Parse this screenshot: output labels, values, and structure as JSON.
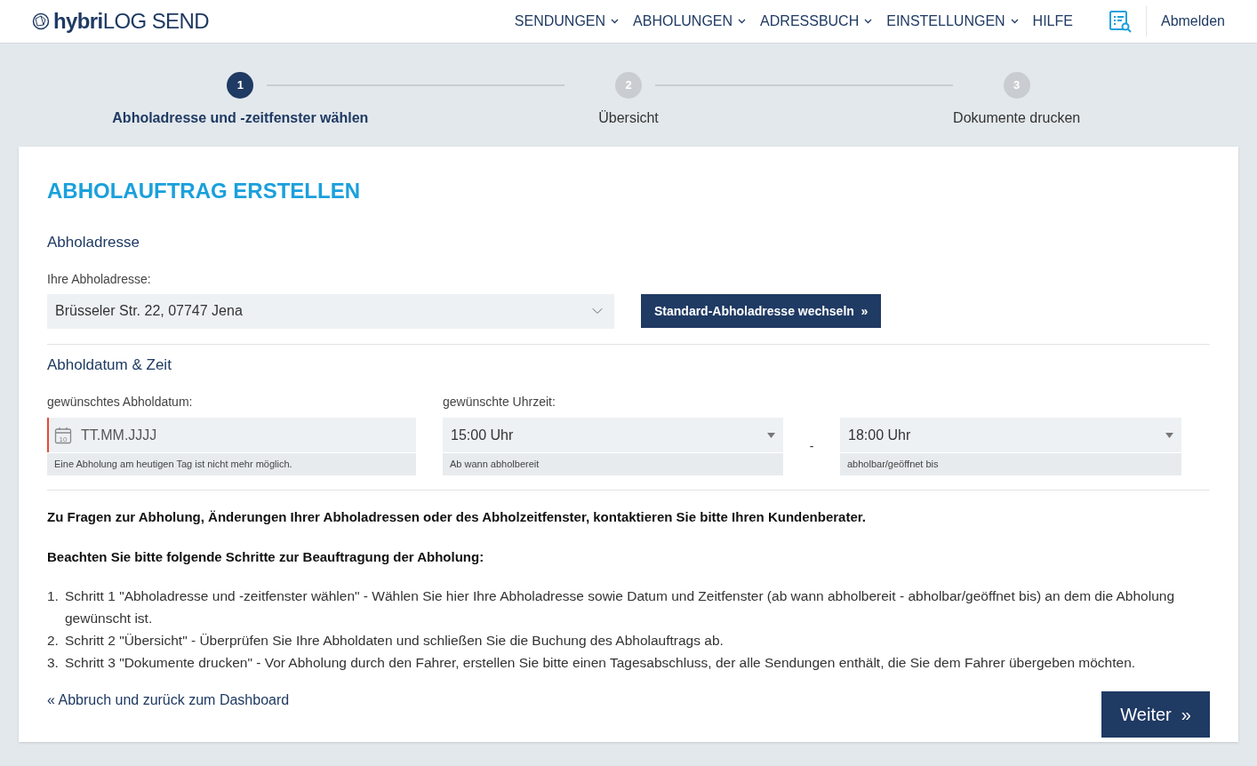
{
  "header": {
    "logo": "**hybri**LOG SEND",
    "nav": [
      {
        "label": "SENDUNGEN",
        "kind": "dropdown"
      },
      {
        "label": "ABHOLUNGEN",
        "kind": "dropdown"
      },
      {
        "label": "ADRESSBUCH",
        "kind": "dropdown"
      },
      {
        "label": "EINSTELLUNGEN",
        "kind": "dropdown"
      },
      {
        "label": "HILFE",
        "kind": "link"
      }
    ],
    "logout": "Abmelden"
  },
  "steps": [
    {
      "number": "1",
      "label": "Abholadresse und -zeitfenster wählen",
      "selected": true
    },
    {
      "number": "2",
      "label": "Übersicht",
      "selected": false
    },
    {
      "number": "3",
      "label": "Dokumente drucken",
      "selected": false
    }
  ],
  "title": "ABHOLAUFTRAG ERSTELLEN",
  "address_section": {
    "heading": "Abholadresse",
    "label": "Ihre Abholadresse:",
    "value": "Brüsseler Str. 22, 07747 Jena",
    "button": "Standard-Abholadresse wechseln  »"
  },
  "date_section": {
    "heading": "Abholdatum & Zeit",
    "date": {
      "label": "gewünschtes Abholdatum:",
      "placeholder": "TT.MM.JJJJ",
      "calendar_day": "10",
      "invalid": true,
      "hint": "Eine Abholung am heutigen Tag ist nicht mehr möglich."
    },
    "time_label": "gewünschte Uhrzeit:",
    "from": {
      "value": "15:00 Uhr",
      "hint": "Ab wann abholbereit"
    },
    "separator": "-",
    "to": {
      "value": "18:00 Uhr",
      "hint": "abholbar/geöffnet bis"
    }
  },
  "contact_note": "Zu Fragen zur Abholung, Änderungen Ihrer Abholadressen oder des Abholzeitfenster, kontaktieren Sie bitte Ihren Kundenberater.",
  "steps_heading": "Beachten Sie bitte folgende Schritte zur Beauftragung der Abholung:",
  "instructions": [
    {
      "marker": "1.",
      "text": "Schritt 1 \"Abholadresse und -zeitfenster wählen\" - Wählen Sie hier Ihre Abholadresse sowie Datum und Zeitfenster (ab wann abholbereit - abholbar/geöffnet bis) an dem die Abholung gewünscht ist."
    },
    {
      "marker": "2.",
      "text": "Schritt 2 \"Übersicht\" - Überprüfen Sie Ihre Abholdaten und schließen Sie die Buchung des Abholauftrags ab."
    },
    {
      "marker": "3.",
      "text": "Schritt 3 \"Dokumente drucken\" - Vor Abholung durch den Fahrer, erstellen Sie bitte einen Tagesabschluss, der alle Sendungen enthält, die Sie dem Fahrer übergeben möchten."
    }
  ],
  "back_link": "« Abbruch und zurück zum Dashboard",
  "next_button": "Weiter  »"
}
